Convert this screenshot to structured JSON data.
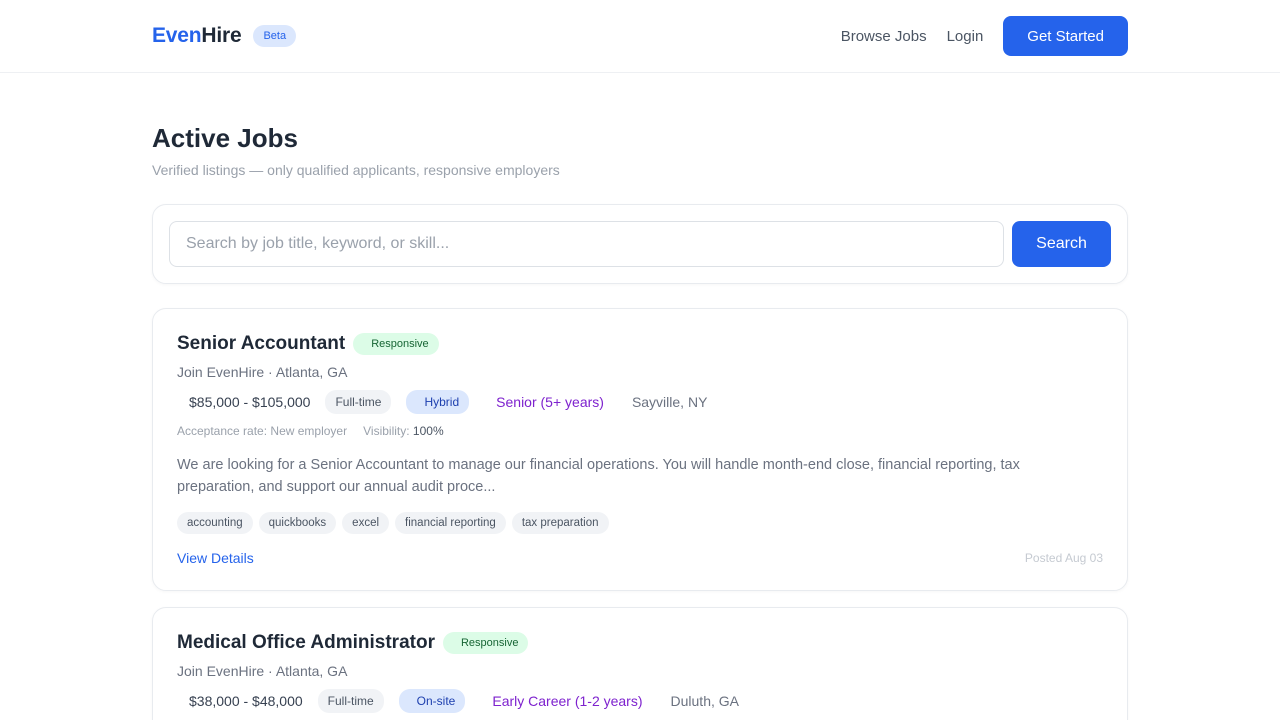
{
  "header": {
    "logo_even": "Even",
    "logo_hire": "Hire",
    "beta": "Beta",
    "nav": {
      "browse": "Browse Jobs",
      "login": "Login",
      "get_started": "Get Started"
    }
  },
  "page": {
    "title": "Active Jobs",
    "subtitle": "Verified listings — only qualified applicants, responsive employers"
  },
  "search": {
    "placeholder": "Search by job title, keyword, or skill...",
    "button": "Search"
  },
  "jobs": [
    {
      "title": "Senior Accountant",
      "badge": "Responsive",
      "company": "Join EvenHire · Atlanta, GA",
      "salary": "$85,000 - $105,000",
      "type": "Full-time",
      "mode": "Hybrid",
      "level": "Senior (5+ years)",
      "location": "Sayville, NY",
      "acceptance_label": "Acceptance rate:",
      "acceptance_value": "New employer",
      "visibility_label": "Visibility:",
      "visibility_value": "100%",
      "description": "We are looking for a Senior Accountant to manage our financial operations. You will handle month-end close, financial reporting, tax preparation, and support our annual audit proce...",
      "tags": [
        "accounting",
        "quickbooks",
        "excel",
        "financial reporting",
        "tax preparation"
      ],
      "view": "View Details",
      "posted": "Posted Aug 03"
    },
    {
      "title": "Medical Office Administrator",
      "badge": "Responsive",
      "company": "Join EvenHire · Atlanta, GA",
      "salary": "$38,000 - $48,000",
      "type": "Full-time",
      "mode": "On-site",
      "level": "Early Career (1-2 years)",
      "location": "Duluth, GA"
    }
  ]
}
